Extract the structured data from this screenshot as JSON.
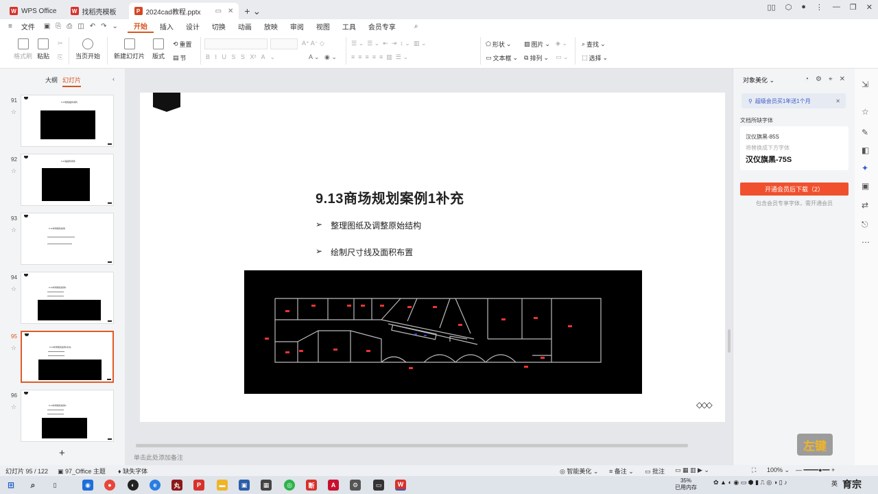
{
  "tabs": [
    {
      "label": "WPS Office",
      "color": "#d7312b",
      "glyph": "W"
    },
    {
      "label": "找稻壳模板",
      "color": "#d7312b",
      "glyph": "W"
    },
    {
      "label": "2024cad教程.pptx",
      "color": "#d24726",
      "glyph": "P"
    }
  ],
  "menu": {
    "file": "文件",
    "items": [
      "开始",
      "插入",
      "设计",
      "切换",
      "动画",
      "放映",
      "审阅",
      "视图",
      "工具",
      "会员专享"
    ],
    "active": "开始"
  },
  "ribbon": {
    "format_painter": "格式刷",
    "paste": "粘贴",
    "from_current": "当页开始",
    "new_slide": "新建幻灯片",
    "layout": "版式",
    "section": "节",
    "reset": "重置",
    "shape": "形状",
    "picture": "图片",
    "find": "查找",
    "textbox": "文本框",
    "arrange": "排列",
    "select": "选择"
  },
  "left_panel": {
    "tab_outline": "大纲",
    "tab_slides": "幻灯片",
    "slides": [
      {
        "num": "91",
        "title": "9.10柜档插件排列",
        "selected": false
      },
      {
        "num": "92",
        "title": "9.11轴组件转换",
        "selected": false
      },
      {
        "num": "93",
        "title": "9.12商场规划案例",
        "selected": false
      },
      {
        "num": "94",
        "title": "9.13商场规划案例1",
        "selected": false
      },
      {
        "num": "95",
        "title": "9.13商场规划案例1补充",
        "selected": true
      },
      {
        "num": "96",
        "title": "9.14商场规划案例2",
        "selected": false
      }
    ],
    "add": "+"
  },
  "slide": {
    "title": "9.13商场规划案例1补充",
    "bullets": [
      "整理图纸及调整原始结构",
      "绘制尺寸线及面积布置"
    ],
    "bullet_marker": "➢",
    "diamonds": "◇◇◇"
  },
  "notes_placeholder": "单击此处添加备注",
  "right_panel": {
    "title": "对象美化",
    "promo": "超级会员买1年送1个月",
    "section": "文档所缺字体",
    "font_missing": "汉仪旗黑-85S",
    "replace_hint": "将替换成下方字体",
    "font_replace": "汉仪旗黑-75S",
    "button": "开通会员后下载（2）",
    "note": "包含会员专享字体，需开通会员"
  },
  "status": {
    "slide_count": "幻灯片 95 / 122",
    "theme": "97_Office 主题",
    "missing_font": "缺失字体",
    "smart": "智能美化",
    "notes": "备注",
    "comments": "批注",
    "zoom": "100%"
  },
  "taskbar": {
    "mem_percent": "35%",
    "mem_label": "已用内存",
    "ime": "英"
  },
  "watermark": "左键",
  "colors": {
    "accent": "#d7541e",
    "button": "#f0502e",
    "promo": "#3a5bc7"
  }
}
